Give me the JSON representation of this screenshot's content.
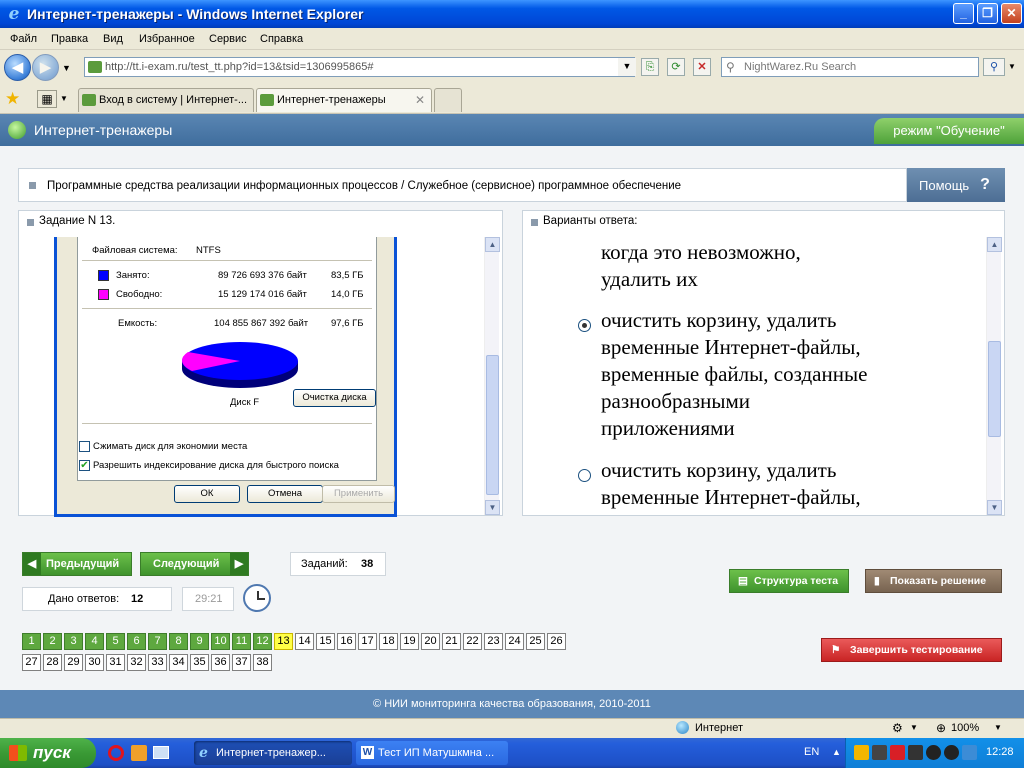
{
  "window": {
    "title": "Интернет-тренажеры - Windows Internet Explorer"
  },
  "menu": [
    "Файл",
    "Правка",
    "Вид",
    "Избранное",
    "Сервис",
    "Справка"
  ],
  "address": {
    "url": "http://tt.i-exam.ru/test_tt.php?id=13&tsid=1306995865#",
    "search_placeholder": "NightWarez.Ru Search"
  },
  "tabs": [
    {
      "label": "Вход в систему | Интернет-..."
    },
    {
      "label": "Интернет-тренажеры"
    }
  ],
  "site": {
    "title": "Интернет-тренажеры",
    "mode": "режим \"Обучение\"",
    "topic": "Программные средства реализации информационных процессов / Служебное (сервисное) программное обеспечение",
    "help": "Помощь",
    "help_icon": "?",
    "task_title": "Задание N 13.",
    "answers_title": "Варианты ответа:"
  },
  "dialog": {
    "fs_label": "Файловая система:",
    "fs_value": "NTFS",
    "used_label": "Занято:",
    "used_bytes": "89 726 693 376 байт",
    "used_gb": "83,5 ГБ",
    "free_label": "Свободно:",
    "free_bytes": "15 129 174 016 байт",
    "free_gb": "14,0 ГБ",
    "cap_label": "Емкость:",
    "cap_bytes": "104 855 867 392 байт",
    "cap_gb": "97,6 ГБ",
    "disk_label": "Диск F",
    "cleanup": "Очистка диска",
    "compress": "Сжимать диск для экономии места",
    "index": "Разрешить индексирование диска для быстрого поиска",
    "ok": "ОК",
    "cancel": "Отмена",
    "apply": "Применить",
    "used_color": "#0000FF",
    "free_color": "#FF00FF"
  },
  "answers": {
    "a1_lines": [
      "когда это невозможно,",
      "удалить их"
    ],
    "a2_lines": [
      "очистить корзину, удалить",
      "временные Интернет-файлы,",
      "временные файлы, созданные",
      "разнообразными",
      "приложениями"
    ],
    "a3_lines": [
      "очистить корзину, удалить",
      "временные Интернет-файлы,"
    ]
  },
  "nav": {
    "prev": "Предыдущий",
    "next": "Следующий",
    "tasks_label": "Заданий:",
    "tasks_count": "38",
    "answered_label": "Дано ответов:",
    "answered_count": "12",
    "timer": "29:21",
    "structure": "Структура теста",
    "show_solution": "Показать решение",
    "finish": "Завершить тестирование"
  },
  "questions": [
    "1",
    "2",
    "3",
    "4",
    "5",
    "6",
    "7",
    "8",
    "9",
    "10",
    "11",
    "12",
    "13",
    "14",
    "15",
    "16",
    "17",
    "18",
    "19",
    "20",
    "21",
    "22",
    "23",
    "24",
    "25",
    "26",
    "27",
    "28",
    "29",
    "30",
    "31",
    "32",
    "33",
    "34",
    "35",
    "36",
    "37",
    "38"
  ],
  "answered_upto": 12,
  "current": 13,
  "footer": "© НИИ мониторинга качества образования, 2010-2011",
  "status": {
    "zone": "Интернет",
    "zoom": "100%"
  },
  "taskbar": {
    "start": "пуск",
    "items": [
      "Интернет-тренажер...",
      "Тест ИП Матушкмна ..."
    ],
    "lang": "EN",
    "clock": "12:28"
  }
}
